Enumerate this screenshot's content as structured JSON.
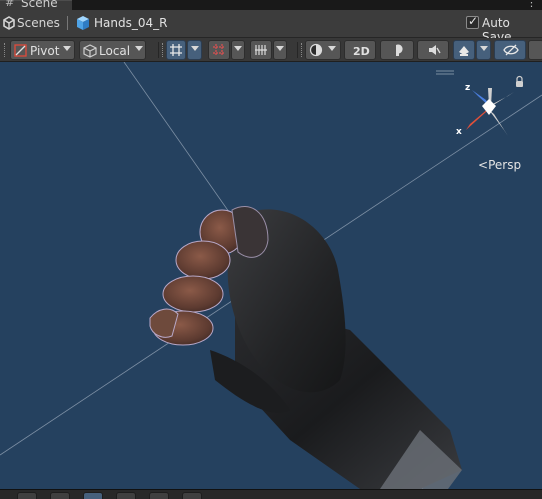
{
  "window": {
    "tab_label": "Scene",
    "tab_icon": "#",
    "menu_icon": "kebab-menu-icon"
  },
  "breadcrumb": {
    "scenes_label": "Scenes",
    "scene_name": "Hands_04_R",
    "autosave_label": "Auto Save",
    "autosave_checked": true
  },
  "toolbar": {
    "pivot_label": "Pivot",
    "local_label": "Local",
    "mode_2d_label": "2D",
    "icons": [
      "pivot-icon",
      "local-icon",
      "grid-snap-icon",
      "increment-snap-icon",
      "grid-display-icon",
      "shading-mode-icon",
      "lighting-icon",
      "audio-icon",
      "effects-icon",
      "scene-visibility-icon"
    ]
  },
  "gizmo": {
    "projection_label": "Persp",
    "axis_z": "z",
    "axis_x": "x",
    "lock_icon": "lock-icon"
  },
  "colors": {
    "viewport_bg": "#25415f",
    "active_button": "#46607c",
    "axis_x": "#e0503a",
    "axis_z": "#4a7fe0"
  }
}
